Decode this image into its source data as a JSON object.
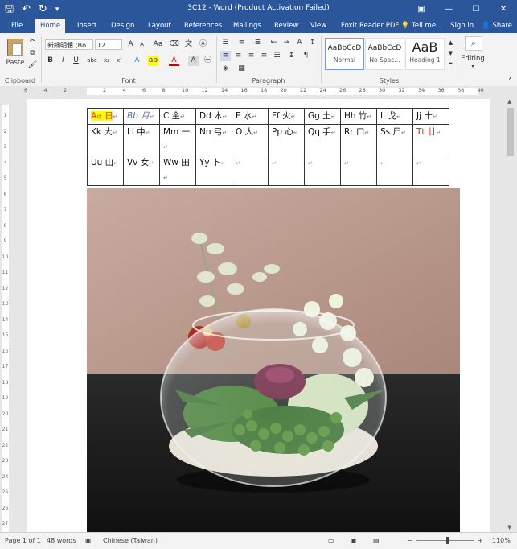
{
  "window": {
    "title": "3C12 - Word (Product Activation Failed)"
  },
  "tabs": [
    {
      "label": "File"
    },
    {
      "label": "Home"
    },
    {
      "label": "Insert"
    },
    {
      "label": "Design"
    },
    {
      "label": "Layout"
    },
    {
      "label": "References"
    },
    {
      "label": "Mailings"
    },
    {
      "label": "Review"
    },
    {
      "label": "View"
    },
    {
      "label": "Foxit Reader PDF"
    }
  ],
  "tabs_right": {
    "tell_me": "Tell me...",
    "sign_in": "Sign in",
    "share": "Share"
  },
  "ribbon": {
    "clipboard": {
      "paste": "Paste",
      "label": "Clipboard"
    },
    "font": {
      "name": "新細明體 (Bo",
      "size": "12",
      "label": "Font"
    },
    "paragraph": {
      "label": "Paragraph"
    },
    "styles": {
      "label": "Styles",
      "items": [
        {
          "sample": "AaBbCcD",
          "name": "Normal"
        },
        {
          "sample": "AaBbCcD",
          "name": "No Spac..."
        },
        {
          "sample": "AaB",
          "name": "Heading 1"
        }
      ]
    },
    "editing": {
      "label": "Editing"
    }
  },
  "table": {
    "rows": [
      [
        "Aa 日",
        "Bb 月",
        "C 金",
        "Dd 木",
        "E 水",
        "Ff 火",
        "Gg 土",
        "Hh 竹",
        "Ii 戈",
        "Jj 十"
      ],
      [
        "Kk 大",
        "Ll 中",
        "Mm 一",
        "Nn 弓",
        "O 人",
        "Pp 心",
        "Qq 手",
        "Rr 口",
        "Ss 尸",
        "Tt 廿"
      ],
      [
        "Uu 山",
        "Vv 女",
        "Ww 田",
        "Yy 卜",
        "",
        "",
        "",
        "",
        "",
        ""
      ]
    ]
  },
  "status": {
    "page": "Page 1 of 1",
    "words": "48 words",
    "language": "Chinese (Taiwan)",
    "zoom": "110%"
  },
  "ruler_numbers": [
    "6",
    "4",
    "2",
    "",
    "2",
    "4",
    "6",
    "8",
    "10",
    "12",
    "14",
    "16",
    "18",
    "20",
    "22",
    "24",
    "26",
    "28",
    "30",
    "32",
    "34",
    "36",
    "38",
    "40"
  ],
  "vruler_numbers": [
    "1",
    "2",
    "3",
    "4",
    "5",
    "6",
    "7",
    "8",
    "9",
    "10",
    "11",
    "12",
    "13",
    "14",
    "15",
    "16",
    "17",
    "18",
    "19",
    "20",
    "21",
    "22",
    "23",
    "24",
    "25",
    "26",
    "27"
  ]
}
